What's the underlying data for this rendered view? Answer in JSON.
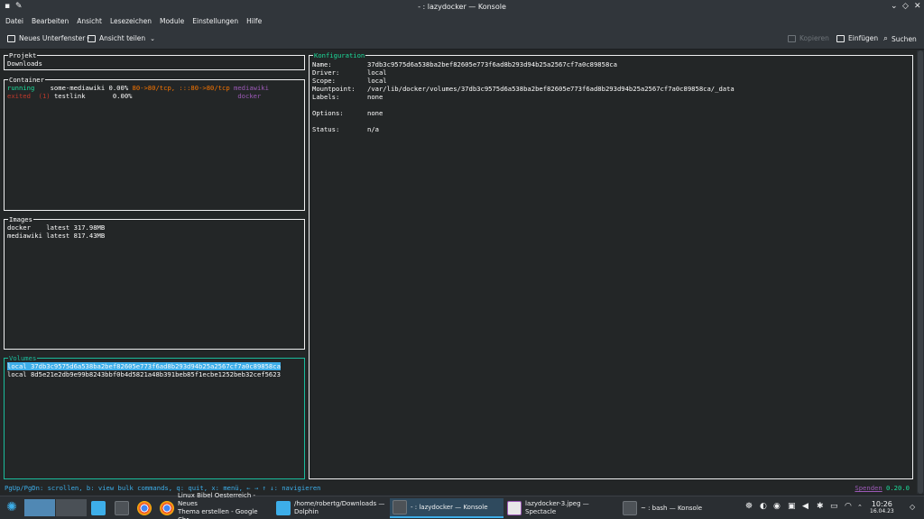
{
  "window": {
    "title": "- : lazydocker — Konsole",
    "controls": [
      "chevron-down-icon",
      "restore-icon",
      "close-icon"
    ]
  },
  "menubar": [
    "Datei",
    "Bearbeiten",
    "Ansicht",
    "Lesezeichen",
    "Module",
    "Einstellungen",
    "Hilfe"
  ],
  "toolbar": {
    "new_tab": "Neues Unterfenster",
    "split_view": "Ansicht teilen",
    "copy": "Kopieren",
    "paste": "Einfügen",
    "find": "Suchen"
  },
  "panels": {
    "project": {
      "title": "Projekt",
      "value": "Downloads"
    },
    "containers": {
      "title": "Container",
      "rows": [
        {
          "status": "running",
          "name": "some-mediawiki",
          "cpu": "0.00%",
          "ports": "80->80/tcp, :::80->80/tcp",
          "image": "mediawiki"
        },
        {
          "status": "exited",
          "code": "(1)",
          "name": "testlink",
          "cpu": "0.00%",
          "ports": "",
          "image": "docker"
        }
      ]
    },
    "images": {
      "title": "Images",
      "rows": [
        {
          "name": "docker",
          "tag": "latest",
          "size": "317.98MB"
        },
        {
          "name": "mediawiki",
          "tag": "latest",
          "size": "817.43MB"
        }
      ]
    },
    "volumes": {
      "title": "Volumes",
      "rows": [
        {
          "driver": "local",
          "name": "37db3c9575d6a538ba2bef82605e773f6ad8b293d94b25a2567cf7a0c89858ca",
          "selected": true
        },
        {
          "driver": "local",
          "name": "8d5e21e2db9e99b8243bbf0b4d5821a48b391beb85f1ecbe1252beb32cef5623",
          "selected": false
        }
      ]
    },
    "config": {
      "title": "Konfiguration",
      "fields": [
        {
          "label": "Name:",
          "value": "37db3c9575d6a538ba2bef82605e773f6ad8b293d94b25a2567cf7a0c89858ca"
        },
        {
          "label": "Driver:",
          "value": "local"
        },
        {
          "label": "Scope:",
          "value": "local"
        },
        {
          "label": "Mountpoint:",
          "value": "/var/lib/docker/volumes/37db3c9575d6a538ba2bef82605e773f6ad8b293d94b25a2567cf7a0c89858ca/_data"
        },
        {
          "label": "Labels:",
          "value": "none"
        },
        {
          "label": "Options:",
          "value": "none"
        },
        {
          "label": "Status:",
          "value": "n/a"
        }
      ]
    }
  },
  "statusbar": {
    "hint": "PgUp/PgDn: scrollen, b: view bulk commands, q: quit, x: menü, ← → ↑ ↓: navigieren",
    "donate": "Spenden",
    "version": "0.20.0"
  },
  "taskbar": {
    "tasks": [
      {
        "label_line1": "Linux Bibel Oesterreich - Neues",
        "label_line2": "Thema erstellen - Google Chr..."
      },
      {
        "label_line1": "/home/robertg/Downloads —",
        "label_line2": "Dolphin"
      },
      {
        "label_line1": "- : lazydocker — Konsole",
        "label_line2": ""
      },
      {
        "label_line1": "lazydocker-3.jpeg — Spectacle",
        "label_line2": ""
      },
      {
        "label_line1": "~ : bash — Konsole",
        "label_line2": ""
      }
    ],
    "clock_time": "10:26",
    "clock_date": "16.04.23",
    "colors": {
      "accent": "#3daee9",
      "green": "#1cdc9a",
      "orange": "#f67400",
      "purple": "#9b59b6",
      "red": "#c0392b"
    }
  }
}
